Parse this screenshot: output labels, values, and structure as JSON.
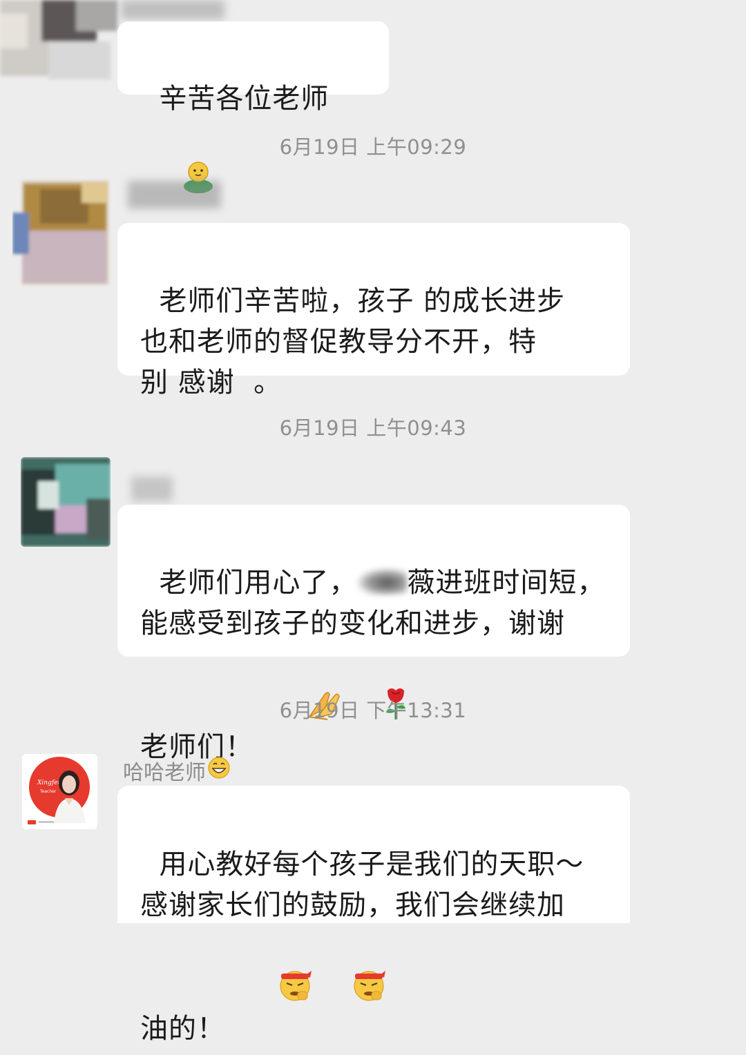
{
  "colors": {
    "background": "#ededed",
    "bubble": "#ffffff",
    "text": "#1b1b1b",
    "timestamp": "#8f8f8f",
    "sender_name": "#8c8c8c",
    "teacher_avatar_bg": "#e63a2e"
  },
  "messages": [
    {
      "avatar_icon": "blurred-avatar-icon",
      "text": "辛苦各位老师",
      "emojis": [
        "green-figure-emoji"
      ]
    },
    {
      "timestamp": "6月19日 上午09:29",
      "avatar_icon": "blurred-avatar-icon",
      "text": "老师们辛苦啦，孩子 的成长进步\n也和老师的督促教导分不开，特\n别 感谢  。"
    },
    {
      "timestamp": "6月19日 上午09:43",
      "avatar_icon": "blurred-avatar-icon",
      "text_before": "老师们用心了，",
      "text_after": "薇进班时间短，\n能感受到孩子的变化和进步，谢谢\n老师们！",
      "emojis": [
        "folded-hands-emoji",
        "rose-emoji"
      ]
    },
    {
      "timestamp": "6月19日 下午13:31",
      "avatar_icon": "teacher-photo-avatar",
      "sender_name": "哈哈老师",
      "sender_emoji": "grinning-face-emoji",
      "text": "用心教好每个孩子是我们的天职～\n感谢家长们的鼓励，我们会继续加\n油的！",
      "emojis": [
        "determined-face-emoji",
        "determined-face-emoji"
      ]
    }
  ]
}
